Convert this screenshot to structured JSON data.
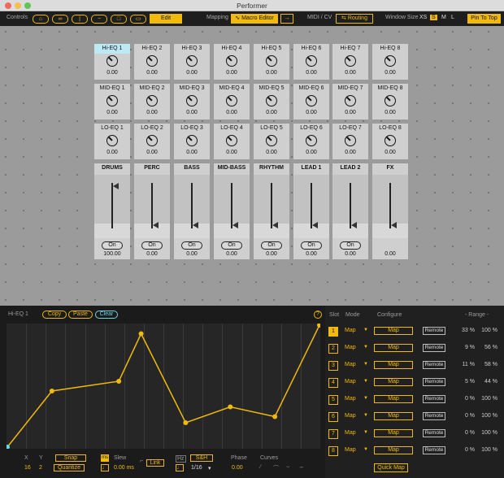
{
  "window": {
    "title": "Performer"
  },
  "toolbar": {
    "controls_label": "Controls",
    "edit_label": "Edit",
    "mapping_label": "Mapping",
    "macro_editor_label": "Macro Editor",
    "midi_cv_label": "MIDI / CV",
    "routing_label": "Routing",
    "window_size_label": "Window Size",
    "sizes": [
      "XS",
      "S",
      "M",
      "L"
    ],
    "selected_size": "S",
    "pin_label": "Pin To Top"
  },
  "hi_eq": [
    {
      "label": "Hi-EQ 1",
      "value": "0.00"
    },
    {
      "label": "Hi-EQ 2",
      "value": "0.00"
    },
    {
      "label": "Hi-EQ 3",
      "value": "0.00"
    },
    {
      "label": "Hi-EQ 4",
      "value": "0.00"
    },
    {
      "label": "Hi-EQ 5",
      "value": "0.00"
    },
    {
      "label": "Hi-EQ 6",
      "value": "0.00"
    },
    {
      "label": "Hi-EQ 7",
      "value": "0.00"
    },
    {
      "label": "Hi-EQ 8",
      "value": "0.00"
    }
  ],
  "mid_eq": [
    {
      "label": "MID-EQ 1",
      "value": "0.00"
    },
    {
      "label": "MID-EQ 2",
      "value": "0.00"
    },
    {
      "label": "MID-EQ 3",
      "value": "0.00"
    },
    {
      "label": "MID-EQ 4",
      "value": "0.00"
    },
    {
      "label": "MID-EQ 5",
      "value": "0.00"
    },
    {
      "label": "MID-EQ 6",
      "value": "0.00"
    },
    {
      "label": "MID-EQ 7",
      "value": "0.00"
    },
    {
      "label": "MID-EQ 8",
      "value": "0.00"
    }
  ],
  "lo_eq": [
    {
      "label": "LO-EQ 1",
      "value": "0.00"
    },
    {
      "label": "LO-EQ 2",
      "value": "0.00"
    },
    {
      "label": "LO-EQ 3",
      "value": "0.00"
    },
    {
      "label": "LO-EQ 4",
      "value": "0.00"
    },
    {
      "label": "LO-EQ 5",
      "value": "0.00"
    },
    {
      "label": "LO-EQ 6",
      "value": "0.00"
    },
    {
      "label": "LO-EQ 7",
      "value": "0.00"
    },
    {
      "label": "LO-EQ 8",
      "value": "0.00"
    }
  ],
  "faders": [
    {
      "name": "DRUMS",
      "on": "On",
      "value": "100.00",
      "level": 1.0
    },
    {
      "name": "PERC",
      "on": "On",
      "value": "0.00",
      "level": 0.0
    },
    {
      "name": "BASS",
      "on": "On",
      "value": "0.00",
      "level": 0.0
    },
    {
      "name": "MID-BASS",
      "on": "On",
      "value": "0.00",
      "level": 0.0
    },
    {
      "name": "RHYTHM",
      "on": "On",
      "value": "0.00",
      "level": 0.0
    },
    {
      "name": "LEAD 1",
      "on": "On",
      "value": "0.00",
      "level": 0.0
    },
    {
      "name": "LEAD 2",
      "on": "On",
      "value": "0.00",
      "level": 0.0
    },
    {
      "name": "FX",
      "on": "",
      "value": "0.00",
      "level": 0.0
    }
  ],
  "macro": {
    "title": "Hi-EQ 1",
    "copy_label": "Copy",
    "paste_label": "Paste",
    "clear_label": "Clear",
    "help_label": "?",
    "curve_points": [
      {
        "x": 0,
        "y": 0.0
      },
      {
        "x": 2,
        "y": 0.46
      },
      {
        "x": 5,
        "y": 0.54
      },
      {
        "x": 6,
        "y": 0.93
      },
      {
        "x": 8,
        "y": 0.2
      },
      {
        "x": 10,
        "y": 0.33
      },
      {
        "x": 12,
        "y": 0.25
      },
      {
        "x": 14,
        "y": 1.0
      }
    ]
  },
  "params": {
    "x_label": "X",
    "x_value": "16",
    "y_label": "Y",
    "y_value": "2",
    "snap_label": "Snap",
    "quantize_label": "Quantize",
    "ms_label": "ms",
    "slew_label": "Slew",
    "slew_value": "0.00 ms",
    "link_label": "Link",
    "hz_label": "Hz",
    "sh_label": "S&H",
    "rate_value": "1/16",
    "phase_label": "Phase",
    "phase_value": "0.00",
    "curves_label": "Curves"
  },
  "mapper": {
    "slot_header": "Slot",
    "mode_header": "Mode",
    "configure_header": "Configure",
    "range_header": "- Range -",
    "rows": [
      {
        "slot": "1",
        "mode": "Map",
        "map": "Map",
        "remote": "Remote",
        "min": "33 %",
        "max": "100 %"
      },
      {
        "slot": "2",
        "mode": "Map",
        "map": "Map",
        "remote": "Remote",
        "min": "9 %",
        "max": "56 %"
      },
      {
        "slot": "3",
        "mode": "Map",
        "map": "Map",
        "remote": "Remote",
        "min": "11 %",
        "max": "58 %"
      },
      {
        "slot": "4",
        "mode": "Map",
        "map": "Map",
        "remote": "Remote",
        "min": "5 %",
        "max": "44 %"
      },
      {
        "slot": "5",
        "mode": "Map",
        "map": "Map",
        "remote": "Remote",
        "min": "0 %",
        "max": "100 %"
      },
      {
        "slot": "6",
        "mode": "Map",
        "map": "Map",
        "remote": "Remote",
        "min": "0 %",
        "max": "100 %"
      },
      {
        "slot": "7",
        "mode": "Map",
        "map": "Map",
        "remote": "Remote",
        "min": "0 %",
        "max": "100 %"
      },
      {
        "slot": "8",
        "mode": "Map",
        "map": "Map",
        "remote": "Remote",
        "min": "0 %",
        "max": "100 %"
      }
    ],
    "quick_map_label": "Quick Map"
  },
  "colors": {
    "accent": "#f0b90b",
    "cyan": "#6fd4e6",
    "panel": "#1b1b1b",
    "cell": "#cfcfcf"
  }
}
